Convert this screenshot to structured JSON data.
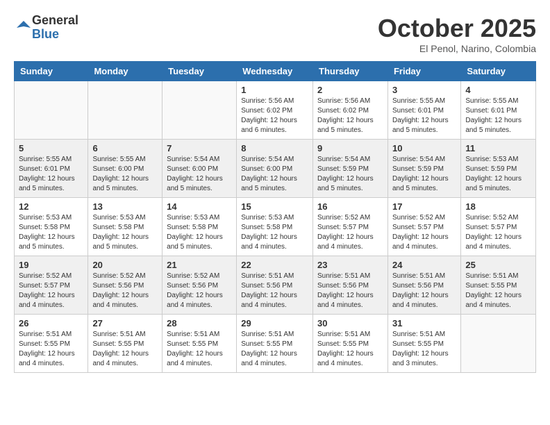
{
  "logo": {
    "general": "General",
    "blue": "Blue"
  },
  "title": "October 2025",
  "location": "El Penol, Narino, Colombia",
  "weekdays": [
    "Sunday",
    "Monday",
    "Tuesday",
    "Wednesday",
    "Thursday",
    "Friday",
    "Saturday"
  ],
  "weeks": [
    [
      {
        "day": "",
        "info": ""
      },
      {
        "day": "",
        "info": ""
      },
      {
        "day": "",
        "info": ""
      },
      {
        "day": "1",
        "info": "Sunrise: 5:56 AM\nSunset: 6:02 PM\nDaylight: 12 hours and 6 minutes."
      },
      {
        "day": "2",
        "info": "Sunrise: 5:56 AM\nSunset: 6:02 PM\nDaylight: 12 hours and 5 minutes."
      },
      {
        "day": "3",
        "info": "Sunrise: 5:55 AM\nSunset: 6:01 PM\nDaylight: 12 hours and 5 minutes."
      },
      {
        "day": "4",
        "info": "Sunrise: 5:55 AM\nSunset: 6:01 PM\nDaylight: 12 hours and 5 minutes."
      }
    ],
    [
      {
        "day": "5",
        "info": "Sunrise: 5:55 AM\nSunset: 6:01 PM\nDaylight: 12 hours and 5 minutes."
      },
      {
        "day": "6",
        "info": "Sunrise: 5:55 AM\nSunset: 6:00 PM\nDaylight: 12 hours and 5 minutes."
      },
      {
        "day": "7",
        "info": "Sunrise: 5:54 AM\nSunset: 6:00 PM\nDaylight: 12 hours and 5 minutes."
      },
      {
        "day": "8",
        "info": "Sunrise: 5:54 AM\nSunset: 6:00 PM\nDaylight: 12 hours and 5 minutes."
      },
      {
        "day": "9",
        "info": "Sunrise: 5:54 AM\nSunset: 5:59 PM\nDaylight: 12 hours and 5 minutes."
      },
      {
        "day": "10",
        "info": "Sunrise: 5:54 AM\nSunset: 5:59 PM\nDaylight: 12 hours and 5 minutes."
      },
      {
        "day": "11",
        "info": "Sunrise: 5:53 AM\nSunset: 5:59 PM\nDaylight: 12 hours and 5 minutes."
      }
    ],
    [
      {
        "day": "12",
        "info": "Sunrise: 5:53 AM\nSunset: 5:58 PM\nDaylight: 12 hours and 5 minutes."
      },
      {
        "day": "13",
        "info": "Sunrise: 5:53 AM\nSunset: 5:58 PM\nDaylight: 12 hours and 5 minutes."
      },
      {
        "day": "14",
        "info": "Sunrise: 5:53 AM\nSunset: 5:58 PM\nDaylight: 12 hours and 5 minutes."
      },
      {
        "day": "15",
        "info": "Sunrise: 5:53 AM\nSunset: 5:58 PM\nDaylight: 12 hours and 4 minutes."
      },
      {
        "day": "16",
        "info": "Sunrise: 5:52 AM\nSunset: 5:57 PM\nDaylight: 12 hours and 4 minutes."
      },
      {
        "day": "17",
        "info": "Sunrise: 5:52 AM\nSunset: 5:57 PM\nDaylight: 12 hours and 4 minutes."
      },
      {
        "day": "18",
        "info": "Sunrise: 5:52 AM\nSunset: 5:57 PM\nDaylight: 12 hours and 4 minutes."
      }
    ],
    [
      {
        "day": "19",
        "info": "Sunrise: 5:52 AM\nSunset: 5:57 PM\nDaylight: 12 hours and 4 minutes."
      },
      {
        "day": "20",
        "info": "Sunrise: 5:52 AM\nSunset: 5:56 PM\nDaylight: 12 hours and 4 minutes."
      },
      {
        "day": "21",
        "info": "Sunrise: 5:52 AM\nSunset: 5:56 PM\nDaylight: 12 hours and 4 minutes."
      },
      {
        "day": "22",
        "info": "Sunrise: 5:51 AM\nSunset: 5:56 PM\nDaylight: 12 hours and 4 minutes."
      },
      {
        "day": "23",
        "info": "Sunrise: 5:51 AM\nSunset: 5:56 PM\nDaylight: 12 hours and 4 minutes."
      },
      {
        "day": "24",
        "info": "Sunrise: 5:51 AM\nSunset: 5:56 PM\nDaylight: 12 hours and 4 minutes."
      },
      {
        "day": "25",
        "info": "Sunrise: 5:51 AM\nSunset: 5:55 PM\nDaylight: 12 hours and 4 minutes."
      }
    ],
    [
      {
        "day": "26",
        "info": "Sunrise: 5:51 AM\nSunset: 5:55 PM\nDaylight: 12 hours and 4 minutes."
      },
      {
        "day": "27",
        "info": "Sunrise: 5:51 AM\nSunset: 5:55 PM\nDaylight: 12 hours and 4 minutes."
      },
      {
        "day": "28",
        "info": "Sunrise: 5:51 AM\nSunset: 5:55 PM\nDaylight: 12 hours and 4 minutes."
      },
      {
        "day": "29",
        "info": "Sunrise: 5:51 AM\nSunset: 5:55 PM\nDaylight: 12 hours and 4 minutes."
      },
      {
        "day": "30",
        "info": "Sunrise: 5:51 AM\nSunset: 5:55 PM\nDaylight: 12 hours and 4 minutes."
      },
      {
        "day": "31",
        "info": "Sunrise: 5:51 AM\nSunset: 5:55 PM\nDaylight: 12 hours and 3 minutes."
      },
      {
        "day": "",
        "info": ""
      }
    ]
  ]
}
